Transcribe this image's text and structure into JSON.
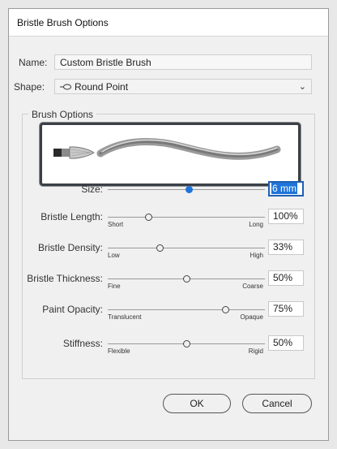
{
  "window": {
    "title": "Bristle Brush Options"
  },
  "name_row": {
    "label": "Name:",
    "value": "Custom Bristle Brush"
  },
  "shape_row": {
    "label": "Shape:",
    "value": "Round Point",
    "icon": "round-point-shape-icon"
  },
  "brush_options": {
    "title": "Brush Options",
    "sliders": [
      {
        "key": "size",
        "label": "Size:",
        "value_text": "6 mm",
        "level": 0.52,
        "min_label": "",
        "max_label": "",
        "active": true
      },
      {
        "key": "bristle_length",
        "label": "Bristle Length:",
        "value_text": "100%",
        "level": 0.26,
        "min_label": "Short",
        "max_label": "Long",
        "active": false
      },
      {
        "key": "bristle_density",
        "label": "Bristle Density:",
        "value_text": "33%",
        "level": 0.33,
        "min_label": "Low",
        "max_label": "High",
        "active": false
      },
      {
        "key": "bristle_thickness",
        "label": "Bristle Thickness:",
        "value_text": "50%",
        "level": 0.5,
        "min_label": "Fine",
        "max_label": "Coarse",
        "active": false
      },
      {
        "key": "paint_opacity",
        "label": "Paint Opacity:",
        "value_text": "75%",
        "level": 0.75,
        "min_label": "Translucent",
        "max_label": "Opaque",
        "active": false
      },
      {
        "key": "stiffness",
        "label": "Stiffness:",
        "value_text": "50%",
        "level": 0.5,
        "min_label": "Flexible",
        "max_label": "Rigid",
        "active": false
      }
    ]
  },
  "buttons": {
    "ok": "OK",
    "cancel": "Cancel"
  },
  "colors": {
    "accent": "#1e74d8",
    "preview_border": "#3c4046"
  }
}
